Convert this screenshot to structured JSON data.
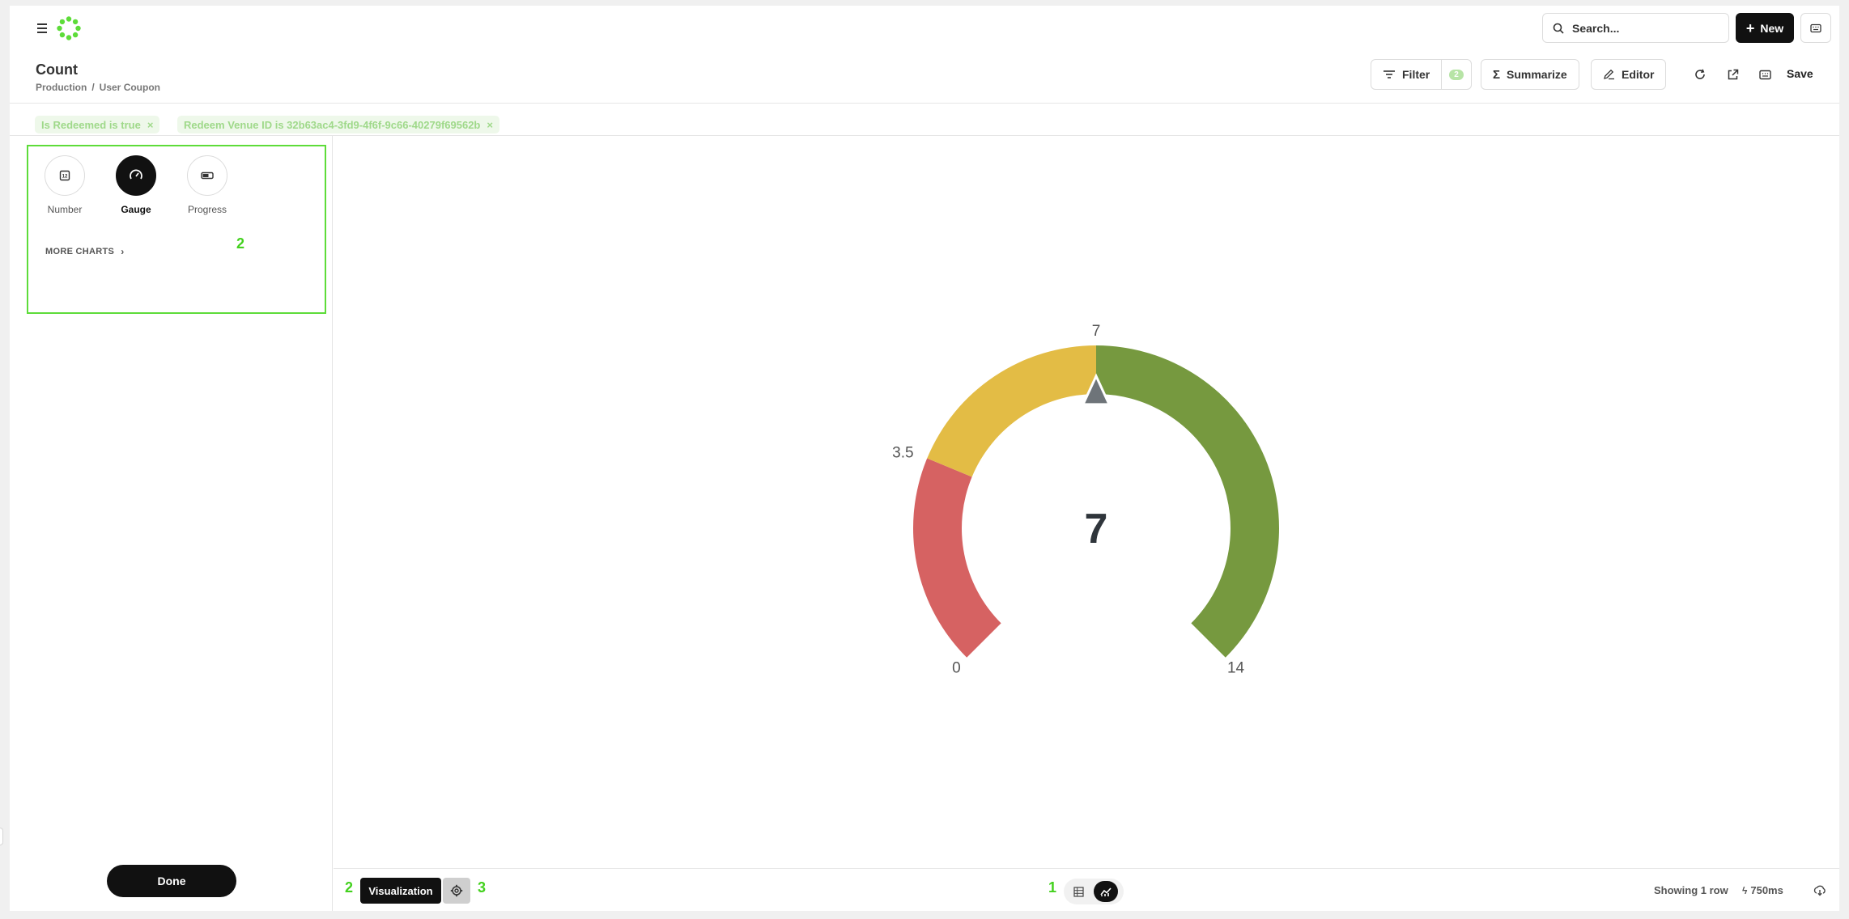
{
  "topnav": {
    "search_placeholder": "Search...",
    "new_label": "New"
  },
  "header": {
    "title": "Count",
    "breadcrumb": [
      "Production",
      "User Coupon"
    ],
    "breadcrumb_sep": "/",
    "filter_label": "Filter",
    "filter_count": "2",
    "summarize_label": "Summarize",
    "editor_label": "Editor",
    "save_label": "Save"
  },
  "filters": [
    {
      "label": "Is Redeemed is true",
      "remove": "×"
    },
    {
      "label": "Redeem Venue ID is 32b63ac4-3fd9-4f6f-9c66-40279f69562b",
      "remove": "×"
    }
  ],
  "sidebar": {
    "options": [
      {
        "label": "Number",
        "icon": "number-icon",
        "active": false
      },
      {
        "label": "Gauge",
        "icon": "gauge-icon",
        "active": true
      },
      {
        "label": "Progress",
        "icon": "progress-icon",
        "active": false
      }
    ],
    "more_charts": "MORE CHARTS",
    "done_label": "Done"
  },
  "markers": {
    "sidebar": "2",
    "footer_left": "2",
    "footer_right": "3",
    "footer_center": "1"
  },
  "chart_data": {
    "type": "gauge",
    "value": 7,
    "value_label": "7",
    "min": 0,
    "max": 14,
    "tick_labels": [
      "0",
      "3.5",
      "7",
      "14"
    ],
    "segments": [
      {
        "from": 0,
        "to": 3.5,
        "color": "#d66262"
      },
      {
        "from": 3.5,
        "to": 7,
        "color": "#e3bc45"
      },
      {
        "from": 7,
        "to": 14,
        "color": "#76993f"
      }
    ]
  },
  "footer": {
    "visualization_label": "Visualization",
    "row_count": "Showing 1 row",
    "timing": "750ms"
  },
  "colors": {
    "accent": "#5ddc39",
    "dark": "#111111"
  }
}
